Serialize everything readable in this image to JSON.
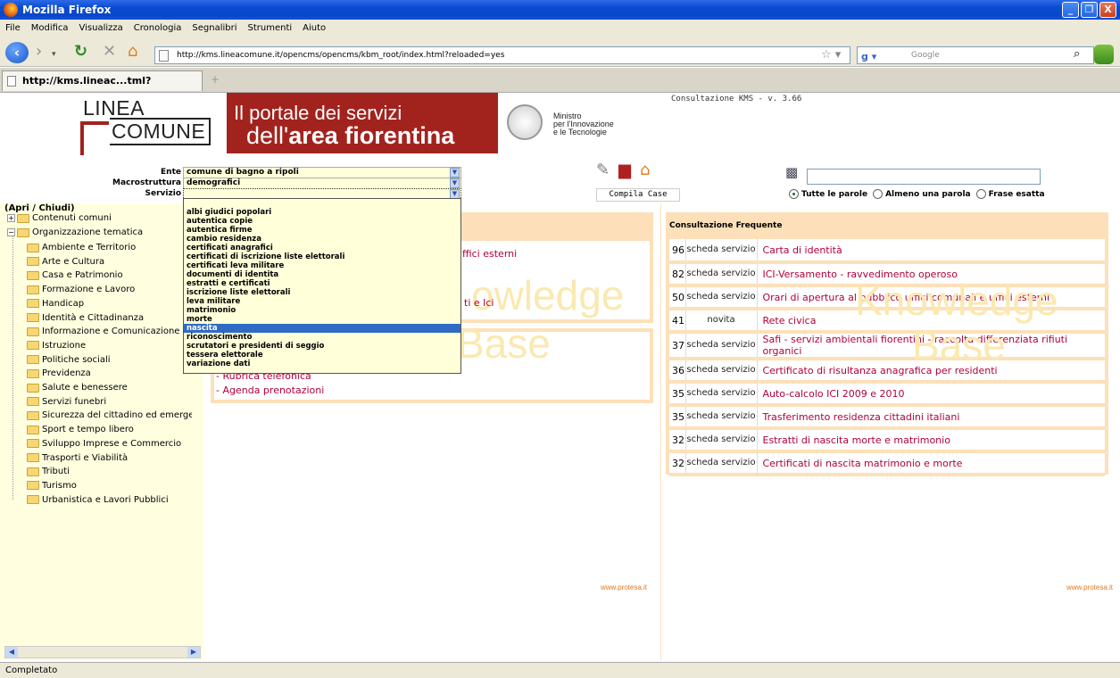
{
  "window": {
    "title": "Mozilla Firefox",
    "buttons": [
      "_",
      "❐",
      "X"
    ]
  },
  "menu": [
    "File",
    "Modifica",
    "Visualizza",
    "Cronologia",
    "Segnalibri",
    "Strumenti",
    "Aiuto"
  ],
  "nav": {
    "url": "http://kms.lineacomune.it/opencms/opencms/kbm_root/index.html?reloaded=yes",
    "search_placeholder": "Google"
  },
  "tab": {
    "title": "http://kms.lineac...tml?reloaded=yes",
    "new_tab": "+"
  },
  "banner": {
    "logo_linea": "LINEA",
    "logo_comune": "COMUNE",
    "portal_line1": "Il portale dei servizi",
    "portal_line2a": "dell'",
    "portal_line2b": "area fiorentina",
    "ministro": [
      "Ministro",
      "per l'Innovazione",
      "e le Tecnologie"
    ],
    "version": "Consultazione KMS - v. 3.66"
  },
  "form": {
    "ente_label": "Ente",
    "ente_value": "comune di bagno a ripoli",
    "macro_label": "Macrostruttura",
    "macro_value": "demografici",
    "servizio_label": "Servizio",
    "servizio_value": ""
  },
  "dropdown": {
    "items": [
      "albi giudici popolari",
      "autentica copie",
      "autentica firme",
      "cambio residenza",
      "certificati anagrafici",
      "certificati di iscrizione liste elettorali",
      "certificati leva militare",
      "documenti di identita",
      "estratti e certificati",
      "iscrizione liste elettorali",
      "leva militare",
      "matrimonio",
      "morte",
      "nascita",
      "riconoscimento",
      "scrutatori e presidenti di seggio",
      "tessera elettorale",
      "variazione dati"
    ],
    "selected": "nascita"
  },
  "tools": {
    "compila": "Compila Case"
  },
  "search_options": {
    "all": "Tutte le parole",
    "any": "Almeno una parola",
    "exact": "Frase esatta"
  },
  "tree": {
    "header": "(Apri / Chiudi)",
    "root1": "Contenuti comuni",
    "root2": "Organizzazione tematica",
    "children": [
      "Ambiente e Territorio",
      "Arte e Cultura",
      "Casa e Patrimonio",
      "Formazione e Lavoro",
      "Handicap",
      "Identità e Cittadinanza",
      "Informazione e Comunicazione",
      "Istruzione",
      "Politiche sociali",
      "Previdenza",
      "Salute e benessere",
      "Servizi funebri",
      "Sicurezza del cittadino ed emergenze",
      "Sport e tempo libero",
      "Sviluppo Imprese e Commercio",
      "Trasporti e Viabilità",
      "Tributi",
      "Turismo",
      "Urbanistica e Lavori Pubblici"
    ]
  },
  "center": {
    "link1": "ffici esterni",
    "link2": "ti e Ici",
    "link3": "- Rubrica telefonica",
    "link4": "- Agenda prenotazioni",
    "watermark1": "owledge",
    "watermark2": "Base",
    "protesa": "www.protesa.it"
  },
  "consultazione": {
    "title": "Consultazione Frequente",
    "rows": [
      {
        "n": "96",
        "type": "scheda servizio",
        "label": "Carta di identità"
      },
      {
        "n": "82",
        "type": "scheda servizio",
        "label": "ICI-Versamento - ravvedimento operoso"
      },
      {
        "n": "50",
        "type": "scheda servizio",
        "label": "Orari di apertura al pubblico uffici comunali e uffici esterni"
      },
      {
        "n": "41",
        "type": "novita",
        "label": "Rete civica"
      },
      {
        "n": "37",
        "type": "scheda servizio",
        "label": "Safi - servizi ambientali fiorentini - raccolta differenziata rifiuti organici"
      },
      {
        "n": "36",
        "type": "scheda servizio",
        "label": "Certificato di risultanza anagrafica per residenti"
      },
      {
        "n": "35",
        "type": "scheda servizio",
        "label": "Auto-calcolo ICI 2009 e 2010"
      },
      {
        "n": "35",
        "type": "scheda servizio",
        "label": "Trasferimento residenza cittadini italiani"
      },
      {
        "n": "32",
        "type": "scheda servizio",
        "label": "Estratti di nascita morte e matrimonio"
      },
      {
        "n": "32",
        "type": "scheda servizio",
        "label": "Certificati di nascita matrimonio e morte"
      }
    ],
    "watermark1": "Knowledge",
    "watermark2": "Base",
    "protesa": "www.protesa.it"
  },
  "status": "Completato"
}
